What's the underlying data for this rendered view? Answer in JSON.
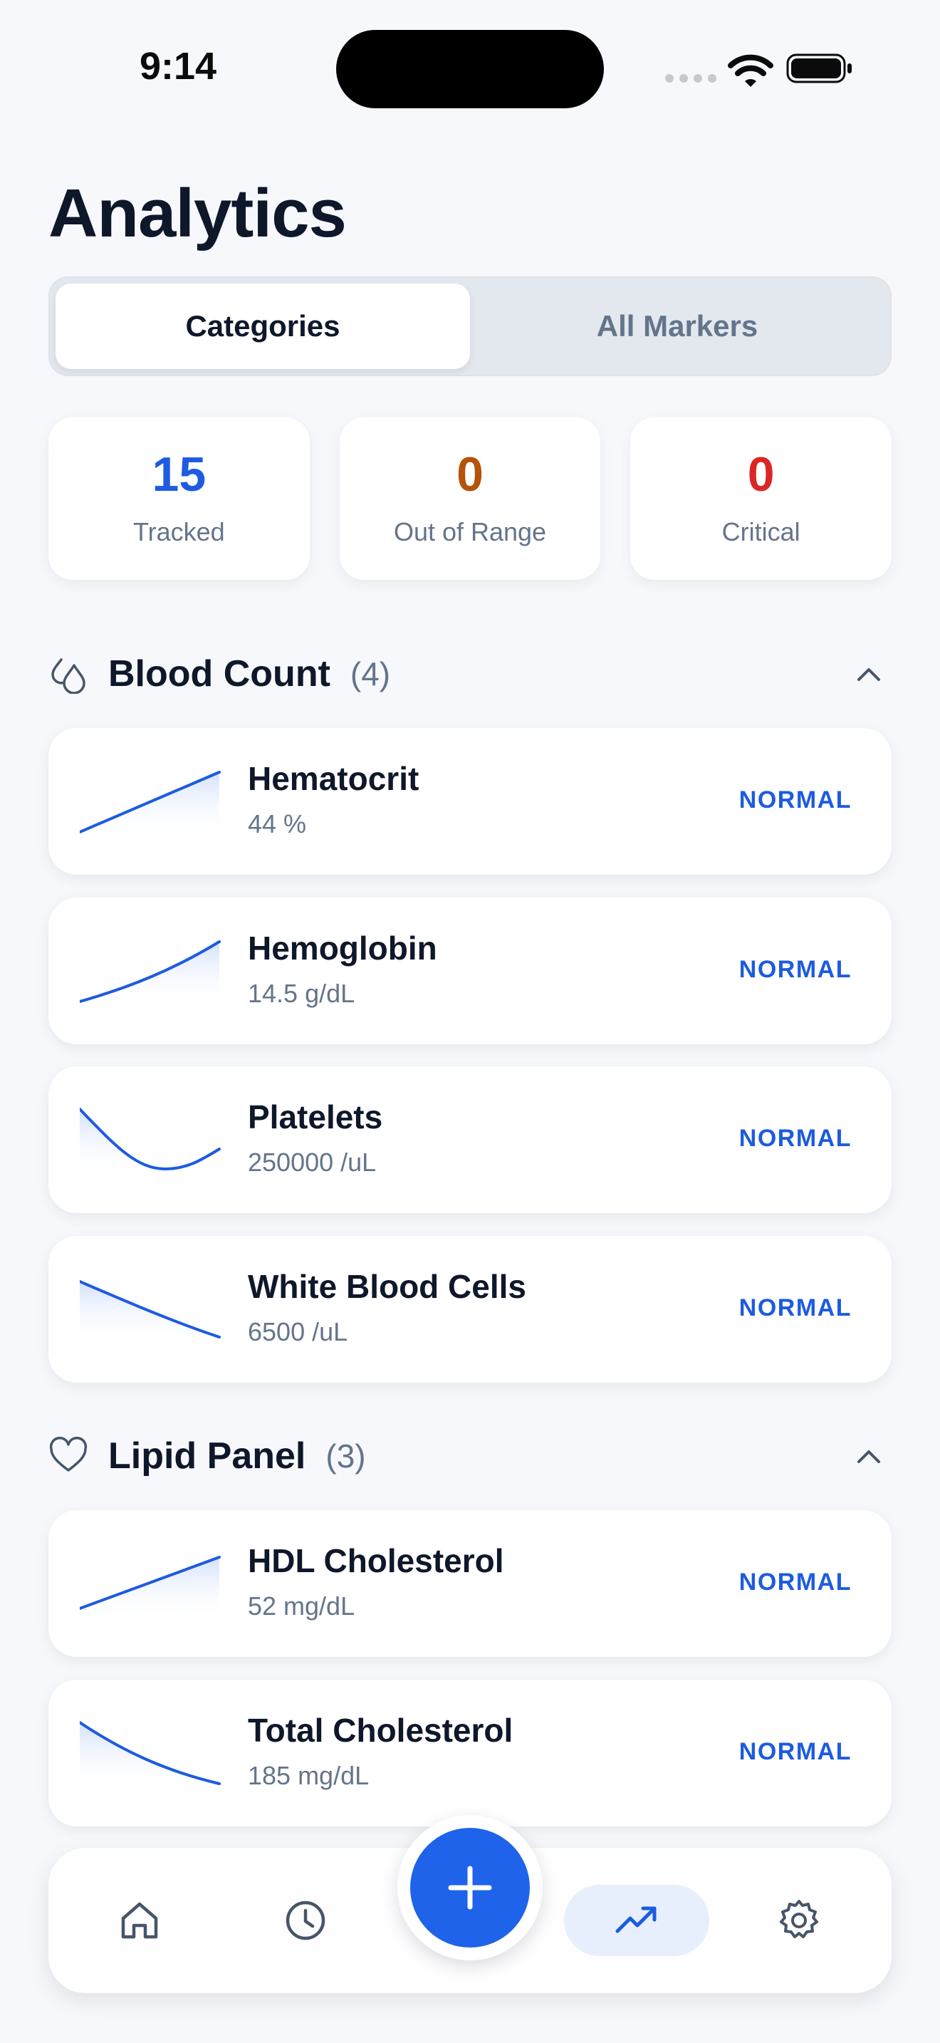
{
  "status_bar": {
    "time": "9:14"
  },
  "page": {
    "title": "Analytics"
  },
  "segments": [
    {
      "label": "Categories",
      "active": true
    },
    {
      "label": "All Markers",
      "active": false
    }
  ],
  "stats": [
    {
      "value": "15",
      "label": "Tracked",
      "color": "#1d5be0"
    },
    {
      "value": "0",
      "label": "Out of Range",
      "color": "#b45309"
    },
    {
      "value": "0",
      "label": "Critical",
      "color": "#dc2626"
    }
  ],
  "sections": [
    {
      "title": "Blood Count",
      "count": "(4)",
      "icon": "drops-icon",
      "markers": [
        {
          "name": "Hematocrit",
          "value": "44 %",
          "status": "NORMAL",
          "trend": "line-up"
        },
        {
          "name": "Hemoglobin",
          "value": "14.5 g/dL",
          "status": "NORMAL",
          "trend": "curve-up"
        },
        {
          "name": "Platelets",
          "value": "250000 /uL",
          "status": "NORMAL",
          "trend": "dip"
        },
        {
          "name": "White Blood Cells",
          "value": "6500 /uL",
          "status": "NORMAL",
          "trend": "down"
        }
      ]
    },
    {
      "title": "Lipid Panel",
      "count": "(3)",
      "icon": "heart-icon",
      "markers": [
        {
          "name": "HDL Cholesterol",
          "value": "52 mg/dL",
          "status": "NORMAL",
          "trend": "line-up"
        },
        {
          "name": "Total Cholesterol",
          "value": "185 mg/dL",
          "status": "NORMAL",
          "trend": "down"
        }
      ]
    }
  ],
  "tabbar": {
    "items": [
      {
        "icon": "home-icon"
      },
      {
        "icon": "clock-icon"
      },
      {
        "icon": "trend-icon",
        "active": true
      },
      {
        "icon": "gear-icon"
      }
    ],
    "fab_icon": "plus-icon"
  },
  "colors": {
    "accent": "#1d5be0",
    "fab": "#1e63e9",
    "warning": "#b45309",
    "critical": "#dc2626"
  }
}
